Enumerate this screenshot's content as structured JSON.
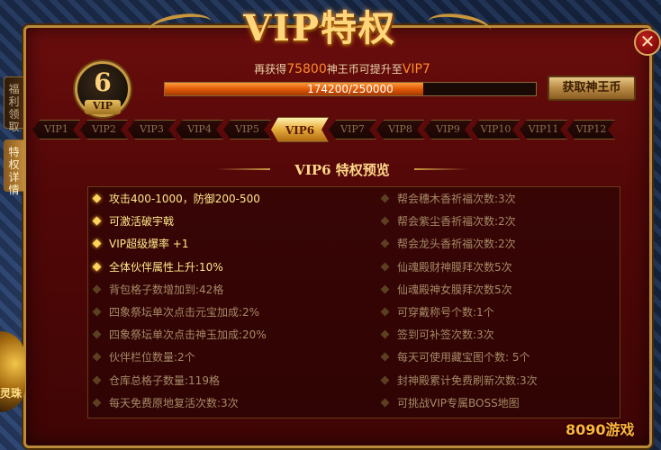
{
  "title": "VIP特权",
  "close_label": "✕",
  "side_tabs": [
    {
      "label": "福利领取",
      "active": false
    },
    {
      "label": "特权详情",
      "active": true
    }
  ],
  "side_emblem_label": "灵珠",
  "vip_badge": {
    "level": "6",
    "label": "VIP"
  },
  "progress": {
    "prefix": "再获得",
    "amount": "75800",
    "middle": "神王币可提升至",
    "target": "VIP7",
    "bar_text": "174200/250000",
    "fraction": 0.6968
  },
  "claim_button": "获取神王币",
  "vip_tabs": [
    "VIP1",
    "VIP2",
    "VIP3",
    "VIP4",
    "VIP5",
    "VIP6",
    "VIP7",
    "VIP8",
    "VIP9",
    "VIP10",
    "VIP11",
    "VIP12"
  ],
  "active_vip_tab": 5,
  "section_title": "VIP6 特权预览",
  "privileges_left": [
    {
      "text": "攻击400-1000，防御200-500",
      "lit": true
    },
    {
      "text": "可激活破宇戟",
      "lit": true
    },
    {
      "text": "VIP超级爆率 +1",
      "lit": true
    },
    {
      "text": "全体伙伴属性上升:10%",
      "lit": true
    },
    {
      "text": "背包格子数增加到:42格",
      "lit": false
    },
    {
      "text": "四象祭坛单次点击元宝加成:2%",
      "lit": false
    },
    {
      "text": "四象祭坛单次点击神玉加成:20%",
      "lit": false
    },
    {
      "text": "伙伴栏位数量:2个",
      "lit": false
    },
    {
      "text": "仓库总格子数量:119格",
      "lit": false
    },
    {
      "text": "每天免费原地复活次数:3次",
      "lit": false
    }
  ],
  "privileges_right": [
    {
      "text": "帮会穗木香祈福次数:3次",
      "lit": false
    },
    {
      "text": "帮会紫尘香祈福次数:2次",
      "lit": false
    },
    {
      "text": "帮会龙头香祈福次数:2次",
      "lit": false
    },
    {
      "text": "仙魂殿财神膜拜次数5次",
      "lit": false
    },
    {
      "text": "仙魂殿神女膜拜次数5次",
      "lit": false
    },
    {
      "text": "可穿戴称号个数:1个",
      "lit": false
    },
    {
      "text": "签到可补签次数:3次",
      "lit": false
    },
    {
      "text": "每天可使用藏宝图个数:  5个",
      "lit": false
    },
    {
      "text": "封神殿累计免费刷新次数:3次",
      "lit": false
    },
    {
      "text": "可挑战VIP专属BOSS地图",
      "lit": false
    }
  ],
  "watermark": "8090游戏",
  "colors": {
    "accent": "#ffd77a",
    "progress": "#e05a08",
    "lit_text": "#ffe98a",
    "dim_text": "#a58a66"
  }
}
